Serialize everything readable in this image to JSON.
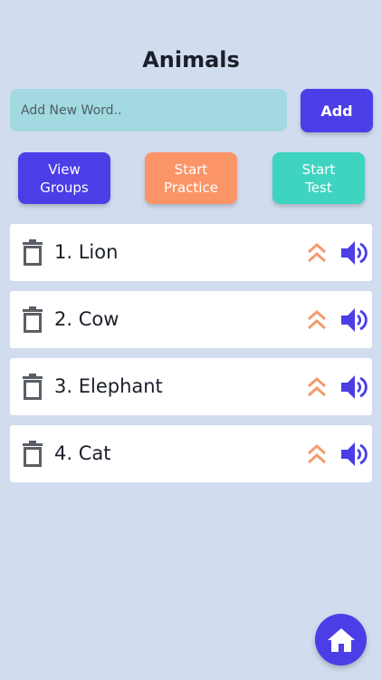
{
  "header": {
    "title": "Animals"
  },
  "new_word": {
    "placeholder": "Add New Word..",
    "add_label": "Add"
  },
  "actions": {
    "view_groups": [
      "View",
      "Groups"
    ],
    "start_practice": [
      "Start",
      "Practice"
    ],
    "start_test": [
      "Start",
      "Test"
    ]
  },
  "words": [
    {
      "label": "1. Lion"
    },
    {
      "label": "2. Cow"
    },
    {
      "label": "3. Elephant"
    },
    {
      "label": "4. Cat"
    }
  ],
  "icons": {
    "row": [
      "trash-icon",
      "double-chevron-up-icon",
      "speaker-icon"
    ],
    "fab": "home-icon"
  },
  "colors": {
    "background": "#d1dcef",
    "primary": "#4b3ee6",
    "practice": "#fb9568",
    "test": "#3fd4bf",
    "input": "#a3d9e0",
    "chevron": "#f49b6e"
  }
}
